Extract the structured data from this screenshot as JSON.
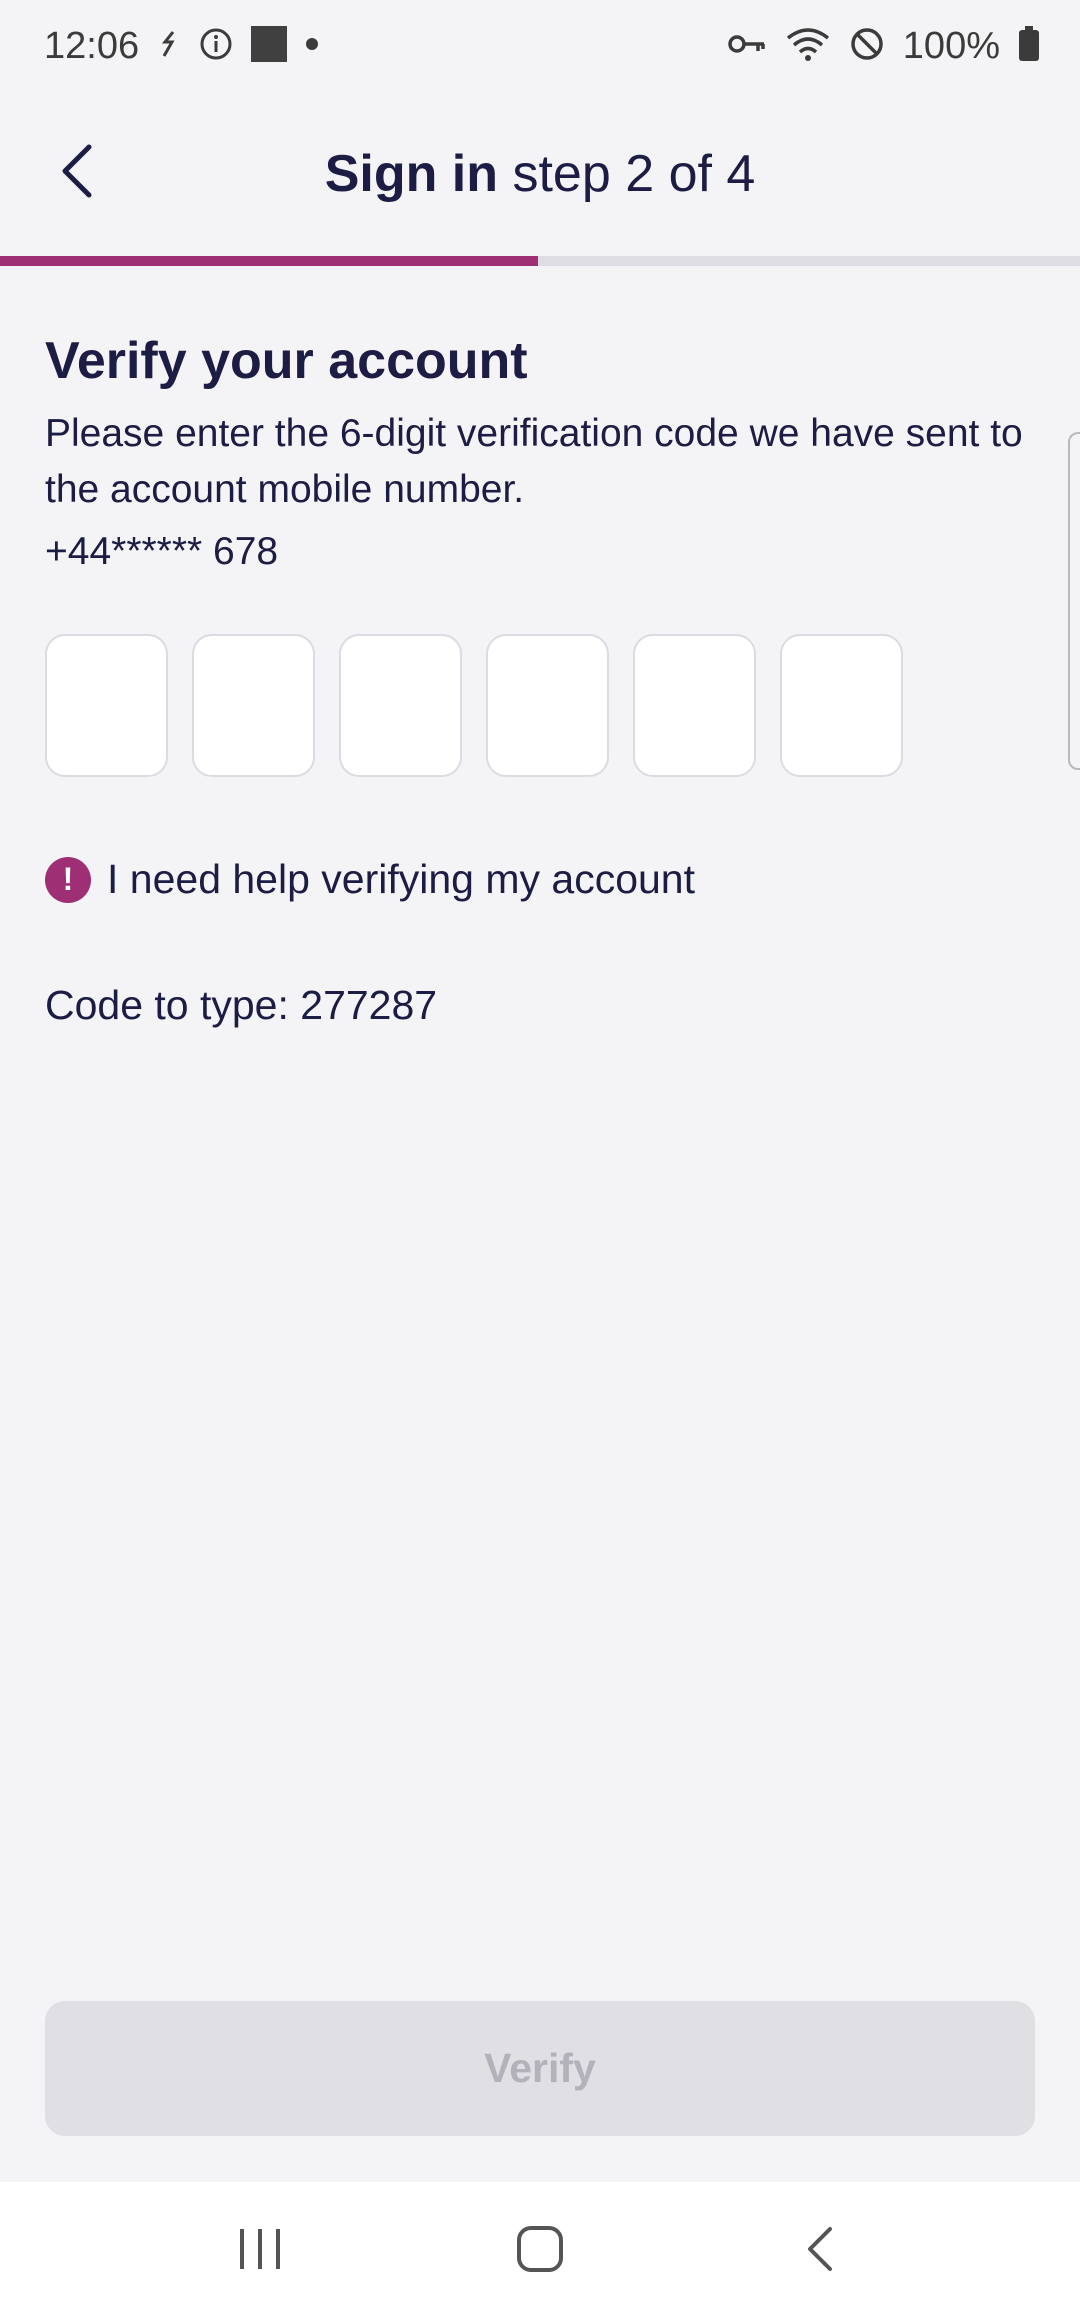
{
  "status_bar": {
    "time": "12:06",
    "battery": "100%"
  },
  "header": {
    "title_bold": "Sign in",
    "title_step": "step 2 of 4"
  },
  "progress": {
    "step": 2,
    "total": 4,
    "fraction": 0.5,
    "fill_color": "#9e2f74"
  },
  "main": {
    "title": "Verify your account",
    "instructions": "Please enter the 6-digit verification code we have sent to the account mobile number.",
    "masked_number": "+44****** 678",
    "code_digits": [
      "",
      "",
      "",
      "",
      "",
      ""
    ],
    "help_link": "I need help verifying my account",
    "code_hint": "Code to type: 277287"
  },
  "footer": {
    "verify_label": "Verify"
  },
  "colors": {
    "accent": "#9e2f74",
    "text": "#1d1c44",
    "background": "#f4f4f6"
  }
}
